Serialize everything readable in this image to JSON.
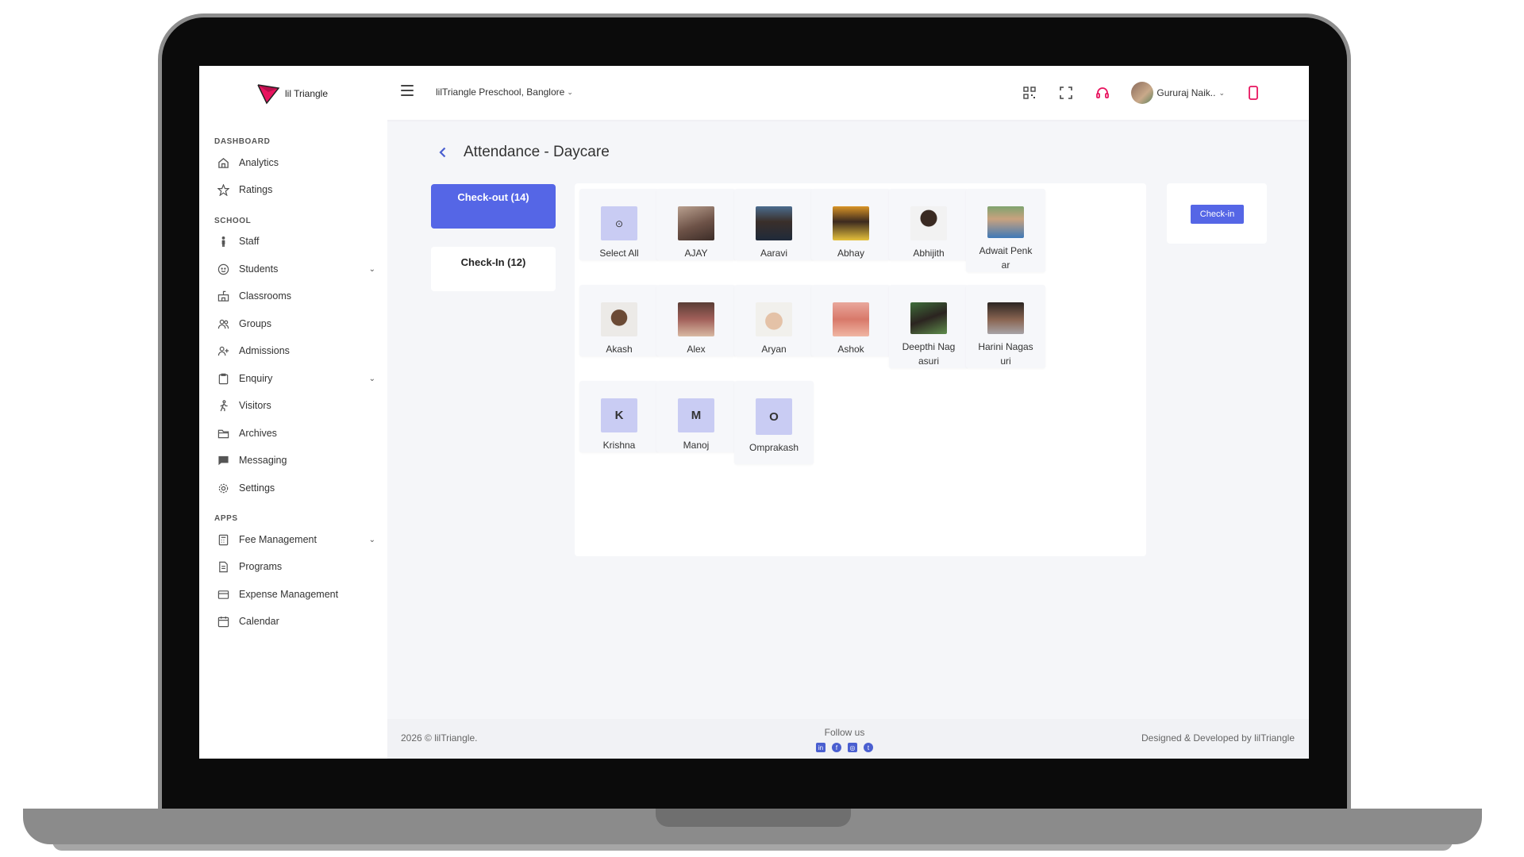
{
  "brand": {
    "name": "lil Triangle",
    "accent": "#5566e6",
    "logo_color": "#e8145f"
  },
  "topbar": {
    "school": "lilTriangle Preschool, Banglore",
    "user_name": "Gururaj Naik..",
    "icons": [
      "qr-grid-icon",
      "fullscreen-icon",
      "headset-icon",
      "mobile-icon"
    ]
  },
  "sidebar": {
    "sections": {
      "dashboard": "DASHBOARD",
      "school": "SCHOOL",
      "apps": "APPS"
    },
    "items": [
      {
        "label": "Analytics",
        "icon": "home-icon"
      },
      {
        "label": "Ratings",
        "icon": "star-icon"
      },
      {
        "label": "Staff",
        "icon": "person-icon"
      },
      {
        "label": "Students",
        "icon": "face-icon",
        "expandable": true
      },
      {
        "label": "Classrooms",
        "icon": "classroom-icon"
      },
      {
        "label": "Groups",
        "icon": "group-icon"
      },
      {
        "label": "Admissions",
        "icon": "add-person-icon"
      },
      {
        "label": "Enquiry",
        "icon": "clipboard-icon",
        "expandable": true
      },
      {
        "label": "Visitors",
        "icon": "walk-icon"
      },
      {
        "label": "Archives",
        "icon": "folder-icon"
      },
      {
        "label": "Messaging",
        "icon": "chat-icon"
      },
      {
        "label": "Settings",
        "icon": "gear-icon"
      },
      {
        "label": "Fee Management",
        "icon": "calculator-icon",
        "expandable": true
      },
      {
        "label": "Programs",
        "icon": "document-icon"
      },
      {
        "label": "Expense Management",
        "icon": "card-icon"
      },
      {
        "label": "Calendar",
        "icon": "calendar-icon"
      }
    ]
  },
  "page": {
    "title": "Attendance - Daycare",
    "tabs": {
      "checkout": "Check-out (14)",
      "checkin": "Check-In (12)"
    },
    "select_all": "Select All",
    "students": [
      {
        "name": "AJAY"
      },
      {
        "name": "Aaravi"
      },
      {
        "name": "Abhay"
      },
      {
        "name": "Abhijith"
      },
      {
        "name": "Adwait Penkar"
      },
      {
        "name": "Akash"
      },
      {
        "name": "Alex"
      },
      {
        "name": "Aryan"
      },
      {
        "name": "Ashok"
      },
      {
        "name": "Deepthi Nagasuri"
      },
      {
        "name": "Harini Nagasuri"
      },
      {
        "name": "Krishna",
        "initial": "K"
      },
      {
        "name": "Manoj",
        "initial": "M"
      },
      {
        "name": "Omprakash",
        "initial": "O"
      }
    ],
    "action_button": "Check-in"
  },
  "footer": {
    "copyright": "2026 © lilTriangle.",
    "follow": "Follow us",
    "credit": "Designed & Developed by lilTriangle",
    "social": [
      "linkedin-icon",
      "facebook-icon",
      "instagram-icon",
      "twitter-icon"
    ]
  }
}
